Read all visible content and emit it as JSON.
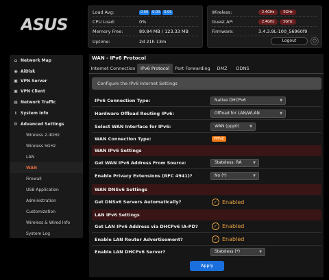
{
  "brand": {
    "logo_text": "ASUS"
  },
  "status": {
    "load_avg_label": "Load Avg:",
    "load_avg": [
      "0.00",
      "0.00",
      "0.00"
    ],
    "cpu_label": "CPU Load:",
    "cpu_value": "0%",
    "memory_label": "Memory Free:",
    "memory_value": "89.84 MB / 123.33 MB",
    "uptime_label": "Uptime:",
    "uptime_value": "2d 21h 13m",
    "wireless_label": "Wireless:",
    "guest_label": "Guest AP:",
    "band_24": "2.4GHz",
    "band_5": "5GHz",
    "firmware_label": "Firmware:",
    "firmware_value": "3.4.3.9L-100_56960f9",
    "logout_label": "Logout",
    "power_icon": "⏻"
  },
  "sidebar": {
    "items": [
      {
        "label": "Network Map",
        "icon": "home-icon",
        "glyph": "⌂"
      },
      {
        "label": "AiDisk",
        "icon": "disk-icon",
        "glyph": "◉"
      },
      {
        "label": "VPN Server",
        "icon": "lock-icon",
        "glyph": "▣"
      },
      {
        "label": "VPN Client",
        "icon": "lock-icon",
        "glyph": "▣"
      },
      {
        "label": "Network Traffic",
        "icon": "chart-icon",
        "glyph": "▤"
      },
      {
        "label": "System Info",
        "icon": "info-icon",
        "glyph": "ℹ"
      },
      {
        "label": "Advanced Settings",
        "icon": "gear-icon",
        "glyph": "⚙"
      }
    ],
    "subitems": [
      "Wireless 2.4GHz",
      "Wireless 5GHz",
      "LAN",
      "WAN",
      "Firewall",
      "USB Application",
      "Administration",
      "Customization",
      "Wireless & Wired Info",
      "System Log"
    ],
    "active": "WAN"
  },
  "page": {
    "title": "WAN - IPv6 Protocol",
    "tabs": [
      "Internet Connection",
      "IPv6 Protocol",
      "Port Forwarding",
      "DMZ",
      "DDNS"
    ],
    "description": "Configure the IPv6 Internet Settings"
  },
  "form": {
    "connection_type_label": "IPv6 Connection Type:",
    "connection_type_value": "Native DHCPv6",
    "offload_label": "Hardware Offload Routing IPv6:",
    "offload_value": "Offload for LAN/WLAN",
    "wan_if_label": "Select WAN Interface for IPv6:",
    "wan_if_value": "WAN (ppp0)",
    "wan_conn_type_label": "WAN Connection Type:",
    "wan_conn_type_value": "PPPoE",
    "sec_wan": "WAN IPv6 Settings",
    "addr_source_label": "Get WAN IPv6 Address From Source:",
    "addr_source_value": "Stateless: RA",
    "privacy_label": "Enable Privacy Extensions (RFC 4941)?",
    "privacy_value": "No (*)",
    "sec_dns": "WAN DNSv6 Settings",
    "dns_auto_label": "Get DNSv6 Servers Automatically?",
    "dns_auto_value": "Enabled",
    "sec_lan": "LAN IPv6 Settings",
    "pd_label": "Get LAN IPv6 Address via DHCPv6 IA-PD?",
    "pd_value": "Enabled",
    "ra_label": "Enable LAN Router Advertisement?",
    "ra_value": "Enabled",
    "dhcpv6_label": "Enable LAN DHCPv6 Server?",
    "dhcpv6_value": "Stateless (*)",
    "apply_label": "Apply"
  },
  "colors": {
    "accent": "#e06b3f",
    "primary": "#1b6fdc",
    "section": "#3a1515",
    "check": "#e8a042"
  }
}
